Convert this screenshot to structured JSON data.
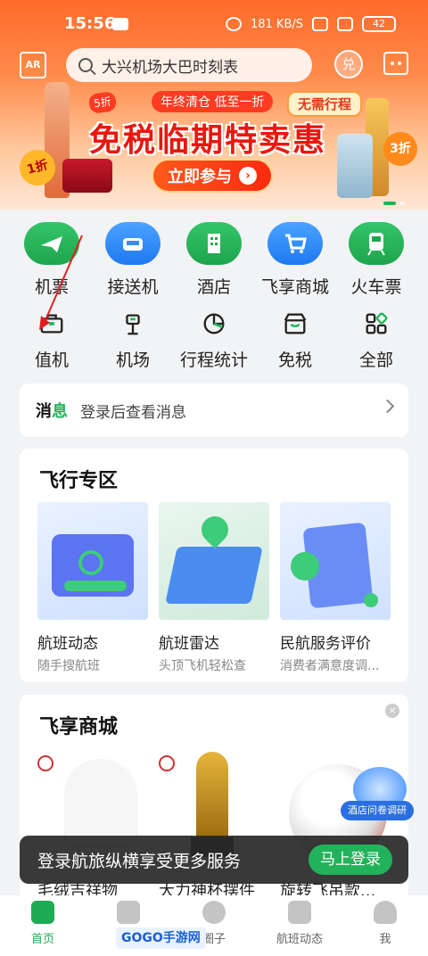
{
  "status": {
    "time": "15:56",
    "net_speed": "181 KB/S",
    "battery": "42"
  },
  "header": {
    "ar_label": "AR",
    "search_placeholder": "大兴机场大巴时刻表",
    "redeem_label": "兑"
  },
  "banner": {
    "tag_left": "年终清仓 低至一折",
    "tag_right": "无需行程",
    "title": "免税临期特卖惠",
    "cta": "立即参与",
    "badge_5": "5折",
    "badge_1": "1折",
    "badge_3": "3折"
  },
  "services": {
    "primary": [
      {
        "label": "机票",
        "icon": "plane-icon"
      },
      {
        "label": "接送机",
        "icon": "car-icon"
      },
      {
        "label": "酒店",
        "icon": "hotel-icon"
      },
      {
        "label": "飞享商城",
        "icon": "cart-icon"
      },
      {
        "label": "火车票",
        "icon": "train-icon"
      }
    ],
    "secondary": [
      {
        "label": "值机",
        "icon": "checkin-icon"
      },
      {
        "label": "机场",
        "icon": "airport-icon"
      },
      {
        "label": "行程统计",
        "icon": "pie-chart-icon"
      },
      {
        "label": "免税",
        "icon": "store-icon"
      },
      {
        "label": "全部",
        "icon": "grid-icon"
      }
    ]
  },
  "messages": {
    "label_part1": "消",
    "label_part2": "息",
    "text": "登录后查看消息"
  },
  "flight_zone": {
    "title": "飞行专区",
    "items": [
      {
        "name": "航班动态",
        "sub": "随手搜航班"
      },
      {
        "name": "航班雷达",
        "sub": "头顶飞机轻松查"
      },
      {
        "name": "民航服务评价",
        "sub": "消费者满意度调..."
      }
    ]
  },
  "shop": {
    "title": "飞享商城",
    "items": [
      {
        "name": "毛绒吉祥物"
      },
      {
        "name": "大力神杯摆件"
      },
      {
        "name": "旋转飞吊款..."
      }
    ],
    "survey_label": "酒店问卷调研"
  },
  "login_toast": {
    "text": "登录航旅纵横享受更多服务",
    "button": "马上登录"
  },
  "tabbar": [
    {
      "label": "首页",
      "active": true
    },
    {
      "label": ""
    },
    {
      "label": "圈子"
    },
    {
      "label": "航班动态"
    },
    {
      "label": "我"
    }
  ],
  "watermark": "GOGO手游网",
  "colors": {
    "brand_green": "#1faa55",
    "banner_orange": "#ff6a2a"
  }
}
